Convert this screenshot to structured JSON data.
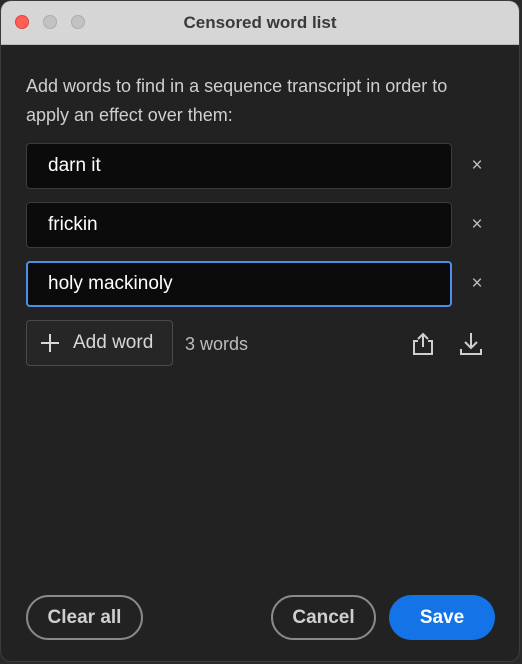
{
  "window": {
    "title": "Censored word list"
  },
  "dialog": {
    "description": "Add words to find in a sequence transcript in order to apply an effect over them:",
    "words": [
      {
        "value": "darn it",
        "remove_label": "×"
      },
      {
        "value": "frickin",
        "remove_label": "×"
      },
      {
        "value": "holy mackinoly",
        "remove_label": "×"
      }
    ],
    "add_button_label": "Add word",
    "word_count": "3 words",
    "icons": {
      "export": "share-export-icon",
      "import": "download-import-icon",
      "add": "plus-icon",
      "remove": "close-icon"
    }
  },
  "footer": {
    "clear_all_label": "Clear all",
    "cancel_label": "Cancel",
    "save_label": "Save"
  },
  "colors": {
    "accent": "#1473e6",
    "focus_ring": "#4d8ee9",
    "close_light": "#ff5f57"
  }
}
